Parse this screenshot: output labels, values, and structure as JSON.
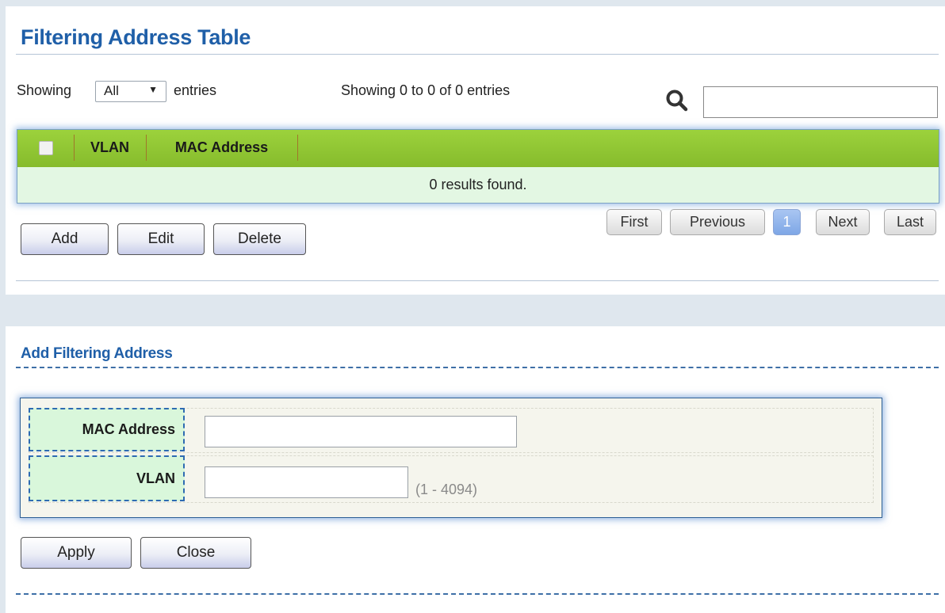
{
  "table_section": {
    "title": "Filtering Address Table",
    "showing_label": "Showing",
    "entries_select_value": "All",
    "entries_label": "entries",
    "info_text": "Showing 0 to 0 of 0 entries",
    "search_value": "",
    "columns": [
      "VLAN",
      "MAC Address"
    ],
    "empty_message": "0 results found.",
    "buttons": {
      "add": "Add",
      "edit": "Edit",
      "delete": "Delete"
    },
    "pagination": {
      "first": "First",
      "previous": "Previous",
      "current": "1",
      "next": "Next",
      "last": "Last"
    }
  },
  "form_section": {
    "title": "Add Filtering Address",
    "mac_label": "MAC Address",
    "mac_value": "",
    "vlan_label": "VLAN",
    "vlan_value": "",
    "vlan_hint": "(1 - 4094)",
    "buttons": {
      "apply": "Apply",
      "close": "Close"
    }
  },
  "colors": {
    "title_blue": "#1f5fa8",
    "header_green": "#8cc431",
    "empty_row_green": "#e3f7e3",
    "label_cell_green": "#d9f7db",
    "active_page_blue": "#8db2ea"
  },
  "icons": {
    "search": "search-icon",
    "select_arrow": "dropdown-arrow-icon"
  }
}
